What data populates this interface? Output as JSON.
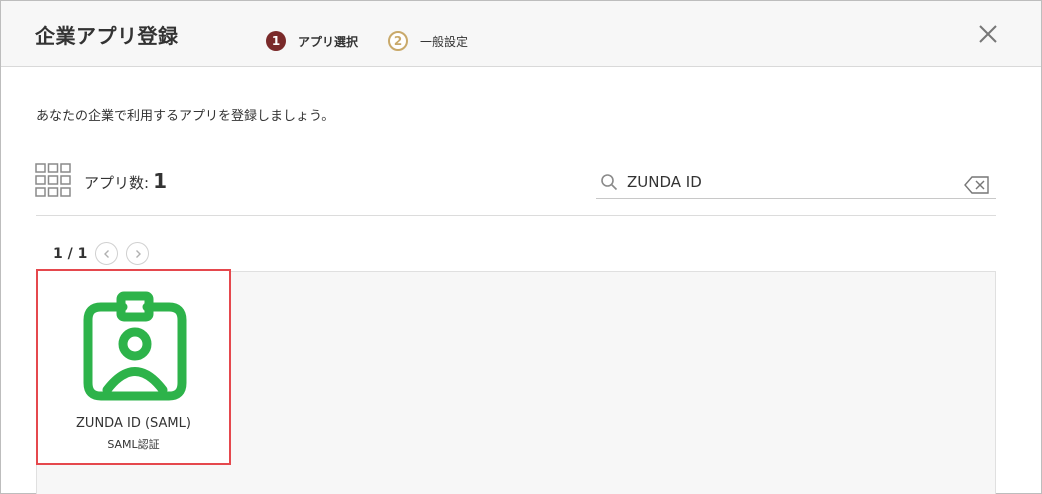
{
  "dialog": {
    "title": "企業アプリ登録",
    "steps": [
      {
        "number": "1",
        "label": "アプリ選択",
        "state": "active"
      },
      {
        "number": "2",
        "label": "一般設定",
        "state": "inactive"
      }
    ]
  },
  "intro_text": "あなたの企業で利用するアプリを登録しましょう。",
  "toolbar": {
    "count_label": "アプリ数:",
    "count_value": "1"
  },
  "search": {
    "value": "ZUNDA ID"
  },
  "pagination": {
    "page_info": "1 / 1"
  },
  "apps": [
    {
      "name": "ZUNDA ID (SAML)",
      "auth": "SAML認証",
      "icon": "id-badge-icon",
      "selected": true
    }
  ],
  "colors": {
    "step_active": "#7a2a2a",
    "step_inactive": "#c9a96a",
    "app_logo": "#2db34a",
    "selection_border": "#e5484d"
  }
}
